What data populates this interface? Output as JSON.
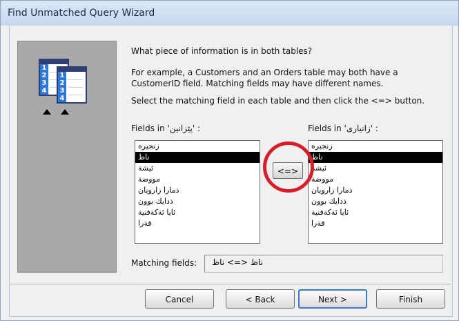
{
  "window": {
    "title": "Find Unmatched Query Wizard"
  },
  "content": {
    "question": "What piece of information is in both tables?",
    "example_line1": "For example, a Customers and an Orders table may both have a",
    "example_line2": "CustomerID field. Matching fields may have different names.",
    "instruction": "Select the matching field in each table and then click the <=> button.",
    "left_label": "Fields in 'پێزانین' :",
    "right_label": "Fields in 'زانیاری' :",
    "left_fields": [
      "زنجيره",
      "ناظ",
      "ئيشة",
      "مووضة",
      "ذمارا زارويان",
      "ذدايك بوون",
      "ئايا ئةكةفنية",
      "قةرا"
    ],
    "right_fields": [
      "زنجيره",
      "ناظ",
      "ئيشة",
      "مووضة",
      "ذمارا زارويان",
      "ذدايك بوون",
      "ئايا ئةكةفنية",
      "قةرا"
    ],
    "selected_index": 1,
    "match_button_label": "<=>",
    "matching_label": "Matching fields:",
    "matching_value": "ناظ <=> ناظ",
    "thumbnail_row_numbers": [
      "1",
      "2",
      "3",
      "4"
    ]
  },
  "buttons": {
    "cancel": "Cancel",
    "back": "< Back",
    "next": "Next >",
    "finish": "Finish"
  }
}
